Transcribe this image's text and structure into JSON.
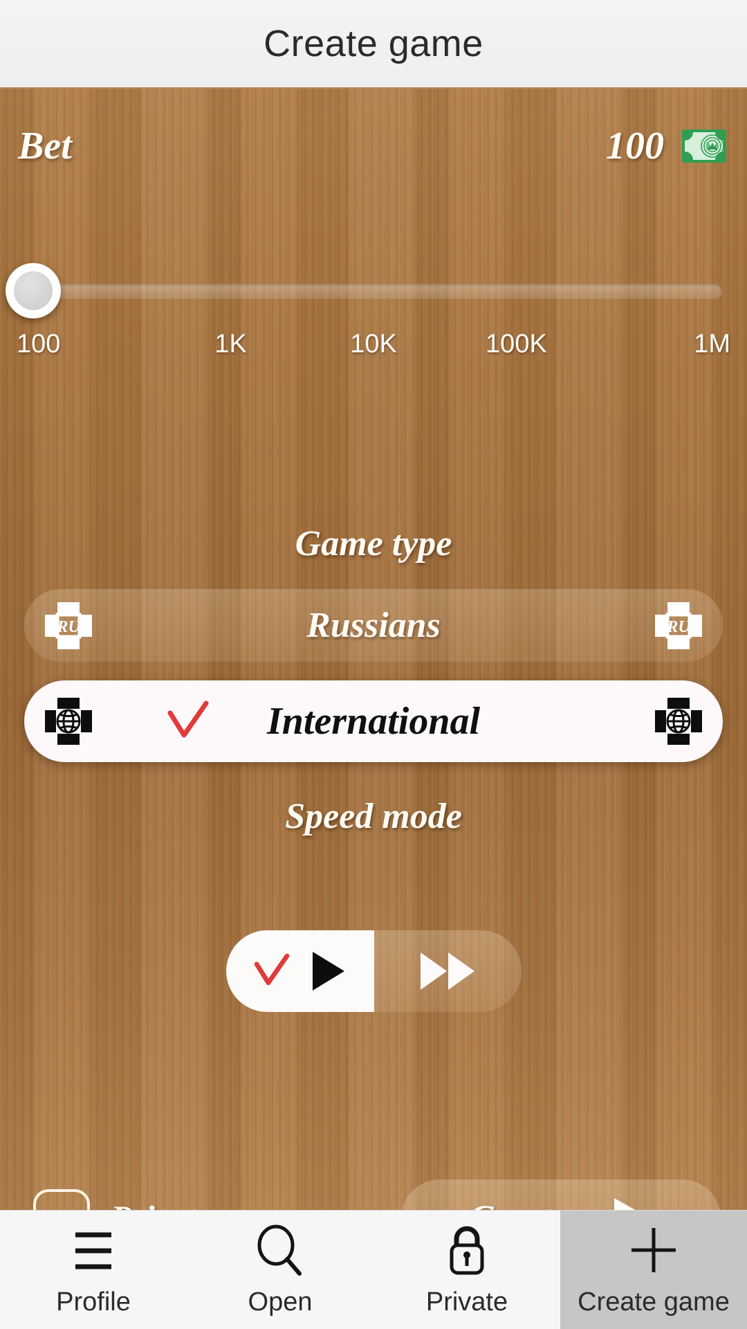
{
  "header": {
    "title": "Create game"
  },
  "bet": {
    "label": "Bet",
    "value": "100",
    "money_icon": "banknote-icon",
    "slider": {
      "thumb_position_percent": 0,
      "ticks": [
        "100",
        "1K",
        "10K",
        "100K",
        "1M"
      ],
      "min": "100",
      "max": "1M"
    }
  },
  "game_type": {
    "title": "Game type",
    "options": [
      {
        "label": "Russians",
        "selected": false,
        "icon_left": "ru-board-icon",
        "icon_right": "ru-board-icon",
        "icon_text": "RU"
      },
      {
        "label": "International",
        "selected": true,
        "icon_left": "globe-board-icon",
        "icon_right": "globe-board-icon",
        "check_icon": "red-check-icon"
      }
    ]
  },
  "speed_mode": {
    "title": "Speed mode",
    "options": [
      {
        "name": "normal",
        "icon": "play-icon",
        "selected": true,
        "check_icon": "red-check-icon"
      },
      {
        "name": "fast",
        "icon": "fast-forward-icon",
        "selected": false
      }
    ]
  },
  "bottom_controls": {
    "private_game": {
      "label": "Private game",
      "checked": false
    },
    "create_button": {
      "label": "Create",
      "icon": "play-arrow-icon"
    }
  },
  "bottom_nav": {
    "items": [
      {
        "label": "Profile",
        "icon": "hamburger-menu-icon",
        "active": false
      },
      {
        "label": "Open",
        "icon": "search-icon",
        "active": false
      },
      {
        "label": "Private",
        "icon": "lock-icon",
        "active": false
      },
      {
        "label": "Create game",
        "icon": "plus-icon",
        "active": true
      }
    ]
  },
  "colors": {
    "wood": "#a9733f",
    "accent_white": "#fffdf6",
    "check_red": "#e03a3a",
    "nav_active_bg": "#c6c6c6",
    "money_green": "#2f9e52"
  }
}
